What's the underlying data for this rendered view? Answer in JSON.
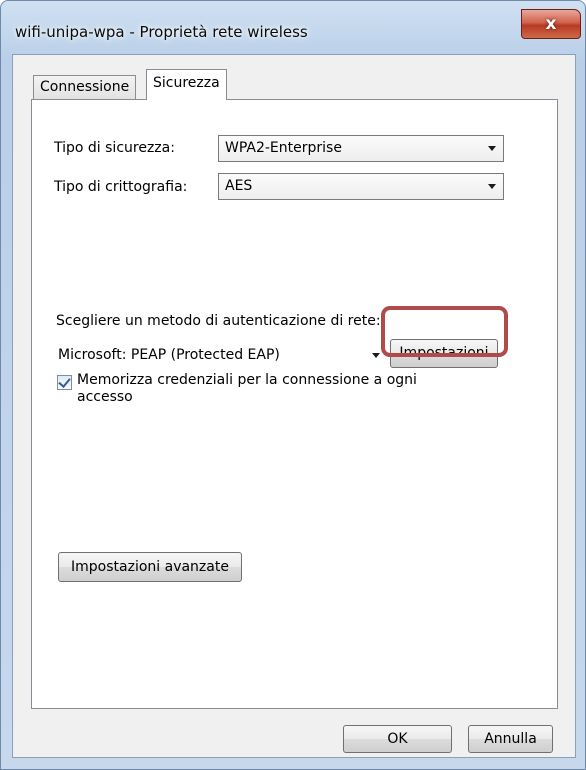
{
  "window": {
    "title": "wifi-unipa-wpa - Proprietà rete wireless",
    "close_glyph": "x"
  },
  "tabs": [
    {
      "label": "Connessione",
      "selected": false
    },
    {
      "label": "Sicurezza",
      "selected": true
    }
  ],
  "security": {
    "type_label": "Tipo di sicurezza:",
    "type_value": "WPA2-Enterprise",
    "encryption_label": "Tipo di crittografia:",
    "encryption_value": "AES",
    "auth_method_label": "Scegliere un metodo di autenticazione di rete:",
    "auth_method_value": "Microsoft: PEAP (Protected EAP)",
    "settings_button": "Impostazioni",
    "remember_credentials_label": "Memorizza credenziali per la connessione a ogni accesso",
    "remember_credentials_checked": true,
    "advanced_button": "Impostazioni avanzate"
  },
  "footer": {
    "ok_button": "OK",
    "cancel_button": "Annulla"
  },
  "colors": {
    "highlight": "#b14a4a"
  }
}
